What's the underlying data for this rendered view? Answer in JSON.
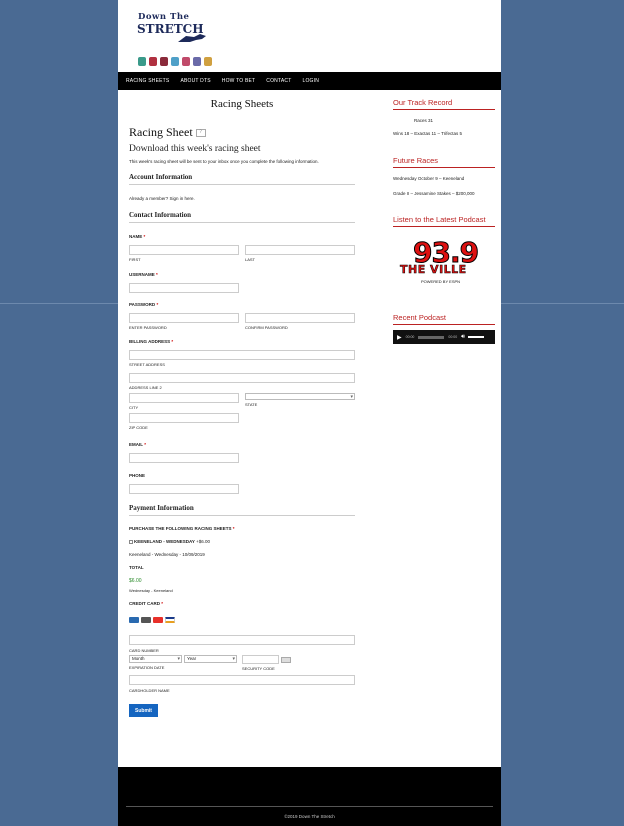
{
  "logo": {
    "line1": "Down The",
    "line2": "STRETCH"
  },
  "nav": [
    "RACING SHEETS",
    "ABOUT DTS",
    "HOW TO BET",
    "CONTACT",
    "LOGIN"
  ],
  "page_title": "Racing Sheets",
  "form": {
    "title": "Racing Sheet",
    "help": "?",
    "download": "Download this week's racing sheet",
    "intro": "This week's racing sheet will be sent to your inbox once you complete the following information.",
    "account_heading": "Account Information",
    "member_text": "Already a member? Sign in here.",
    "contact_heading": "Contact Information",
    "name_label": "NAME",
    "first": "FIRST",
    "last": "LAST",
    "username_label": "USERNAME",
    "password_label": "PASSWORD",
    "enter_password": "ENTER PASSWORD",
    "confirm_password": "CONFIRM PASSWORD",
    "billing_label": "BILLING ADDRESS",
    "street": "STREET ADDRESS",
    "address2": "ADDRESS LINE 2",
    "city": "CITY",
    "state": "STATE",
    "zip": "ZIP CODE",
    "email_label": "EMAIL",
    "phone_label": "PHONE",
    "payment_heading": "Payment Information",
    "purchase_label": "PURCHASE THE FOLLOWING RACING SHEETS",
    "product_name": "KEENELAND - WEDNESDAY",
    "product_price": "$6.00",
    "product_detail": "Keeneland - Wednesday - 10/09/2019",
    "total_label": "TOTAL",
    "total_value": "$6.00",
    "total_detail": "Wednesday - Keeneland",
    "cc_label": "CREDIT CARD",
    "card_number": "CARD NUMBER",
    "month": "Month",
    "year": "Year",
    "expiration": "EXPIRATION DATE",
    "security": "SECURITY CODE",
    "cardholder": "CARDHOLDER NAME",
    "submit": "Submit",
    "required_mark": "*"
  },
  "sidebar": {
    "record_heading": "Our Track Record",
    "races": "Races 31",
    "wins": "Wins 18 – Exactas 11 – Trifectas 5",
    "future_heading": "Future Races",
    "future_1": "Wednesday October 9 – Keeneland",
    "future_2": "Grade II – Jessamine Stakes – $200,000",
    "podcast_heading": "Listen to the Latest Podcast",
    "station_freq": "93.9",
    "station_name": "THE VILLE",
    "station_sub": "POWERED BY ESPN",
    "recent_heading": "Recent Podcast",
    "time_current": "00:00",
    "time_total": "00:00"
  },
  "footer": {
    "text": "©2019 Down The Stretch"
  },
  "colors": {
    "accent": "#b22222",
    "button": "#1565c0",
    "background": "#4a6a93"
  }
}
